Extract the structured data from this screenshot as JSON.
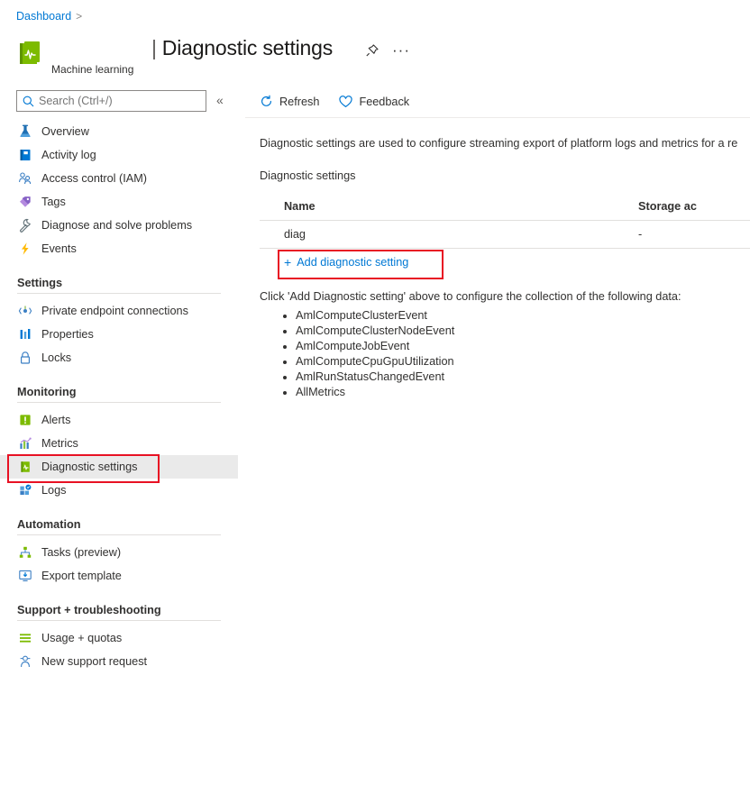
{
  "breadcrumb": {
    "root": "Dashboard",
    "separator": ">"
  },
  "resource": {
    "icon": "machine-learning-icon",
    "subtitle": "Machine learning"
  },
  "header": {
    "title_pipe": "|",
    "title": "Diagnostic settings",
    "pin_icon": "pin-icon",
    "more_icon": "ellipsis-icon",
    "more_glyph": "···"
  },
  "search": {
    "placeholder": "Search (Ctrl+/)",
    "value": "",
    "icon": "search-icon",
    "collapse_icon": "chevron-double-left-icon",
    "collapse_glyph": "«"
  },
  "sidebar": {
    "top_items": [
      {
        "label": "Overview",
        "icon": "flask-icon"
      },
      {
        "label": "Activity log",
        "icon": "book-icon"
      },
      {
        "label": "Access control (IAM)",
        "icon": "people-icon"
      },
      {
        "label": "Tags",
        "icon": "tag-icon"
      },
      {
        "label": "Diagnose and solve problems",
        "icon": "wrench-icon"
      },
      {
        "label": "Events",
        "icon": "lightning-icon"
      }
    ],
    "groups": [
      {
        "title": "Settings",
        "items": [
          {
            "label": "Private endpoint connections",
            "icon": "endpoint-icon"
          },
          {
            "label": "Properties",
            "icon": "properties-icon"
          },
          {
            "label": "Locks",
            "icon": "lock-icon"
          }
        ]
      },
      {
        "title": "Monitoring",
        "items": [
          {
            "label": "Alerts",
            "icon": "alert-icon"
          },
          {
            "label": "Metrics",
            "icon": "metrics-icon"
          },
          {
            "label": "Diagnostic settings",
            "icon": "diagnostic-settings-icon",
            "selected": true,
            "highlighted": true
          },
          {
            "label": "Logs",
            "icon": "logs-icon"
          }
        ]
      },
      {
        "title": "Automation",
        "items": [
          {
            "label": "Tasks (preview)",
            "icon": "tasks-icon"
          },
          {
            "label": "Export template",
            "icon": "export-template-icon"
          }
        ]
      },
      {
        "title": "Support + troubleshooting",
        "items": [
          {
            "label": "Usage + quotas",
            "icon": "usage-quotas-icon"
          },
          {
            "label": "New support request",
            "icon": "support-request-icon"
          }
        ]
      }
    ]
  },
  "main": {
    "commands": [
      {
        "label": "Refresh",
        "icon": "refresh-icon"
      },
      {
        "label": "Feedback",
        "icon": "heart-icon"
      }
    ],
    "description": "Diagnostic settings are used to configure streaming export of platform logs and metrics for a re",
    "section_label": "Diagnostic settings",
    "table": {
      "columns": [
        "Name",
        "Storage ac"
      ],
      "rows": [
        {
          "name": "diag",
          "storage": "-"
        }
      ]
    },
    "add_link": {
      "label": "Add diagnostic setting",
      "plus": "+"
    },
    "hint": "Click 'Add Diagnostic setting' above to configure the collection of the following data:",
    "data_items": [
      "AmlComputeClusterEvent",
      "AmlComputeClusterNodeEvent",
      "AmlComputeJobEvent",
      "AmlComputeCpuGpuUtilization",
      "AmlRunStatusChangedEvent",
      "AllMetrics"
    ]
  },
  "colors": {
    "link": "#0078d4",
    "highlight": "#e81123",
    "selected_bg": "#eaeaea"
  }
}
